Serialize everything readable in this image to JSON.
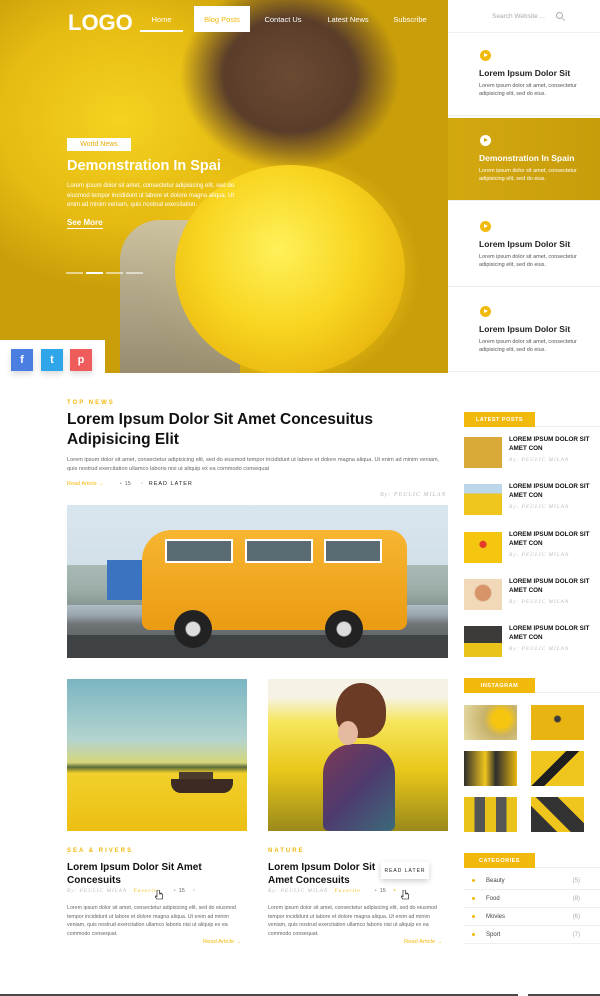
{
  "nav": {
    "logo": "LOGO",
    "items": [
      "Home",
      "Blog Posts",
      "Contact Us",
      "Latest News",
      "Subscribe"
    ],
    "search_placeholder": "Search Website ..."
  },
  "hero": {
    "badge": "World News",
    "title": "Demonstration In Spai",
    "body": "Lorem ipsum dolor sit amet, consectetur adipisicing elit, sed do eiusmod tempor incididunt ut labore et dolore magna aliqua. Ut enim ad minim veniam, quis nostrud exercitation.",
    "more": "See More"
  },
  "social": [
    "f",
    "t",
    "p"
  ],
  "slider_list": [
    {
      "title": "Lorem Ipsum Dolor Sit",
      "text": "Lorem ipsum dolor sit amet, consectetur adipisicing elit, sed do eius."
    },
    {
      "title": "Demonstration In Spain",
      "text": "Lorem ipsum dolor sit amet, consectetur adipisicing elit, sed do eius."
    },
    {
      "title": "Lorem Ipsum Dolor Sit",
      "text": "Lorem ipsum dolor sit amet, consectetur adipisicing elit, sed do eius."
    },
    {
      "title": "Lorem Ipsum Dolor Sit",
      "text": "Lorem ipsum dolor sit amet, consectetur adipisicing elit, sed do eius."
    }
  ],
  "main_article": {
    "kicker": "TOP NEWS",
    "title": "Lorem Ipsum Dolor Sit Amet Concesuitus Adipisicing Elit",
    "body": "Lorem ipsum dolor sit amet, consectetur adipisicing elit, sed do eiusmod tempor incididunt ut labore et dolore magna aliqua. Ut enim ad minim veniam, quis nostrud exercitation ullamco laboris nisi ut aliquip ex ea commodo consequat",
    "read": "Read Article →",
    "comments": "15",
    "read_later": "READ LATER",
    "byline": "By: PEULIC MILAN"
  },
  "cards": [
    {
      "kicker": "SEA & RIVERS",
      "title": "Lorem Ipsum Dolor Sit Amet Concesuits",
      "by": "By: PEULIC MILAN",
      "fav": "Favorite",
      "comments": "15",
      "text": "Lorem ipsum dolor sit amet, consectetur adipisicing elit, sed do eiusmod tempor incididunt ut labore et dolore magna aliqua. Ut enim ad minim veniam, quis nostrud exercitation ullamco laboris nisi ut aliquip ex ea commodo consequat.",
      "read": "Read Article →"
    },
    {
      "kicker": "NATURE",
      "title": "Lorem Ipsum Dolor Sit Amet Concesuits",
      "by": "By: PEULIC MILAN",
      "fav": "Favorite",
      "comments": "15",
      "text": "Lorem ipsum dolor sit amet, consectetur adipisicing elit, sed do eiusmod tempor incididunt ut labore et dolore magna aliqua. Ut enim ad minim veniam, quis nostrud exercitation ullamco laboris nisi ut aliquip ex ea commodo consequat.",
      "read": "Read Article →"
    }
  ],
  "tooltip": "READ LATER",
  "sidebar": {
    "latest_title": "LATEST POSTS",
    "latest": [
      {
        "title": "LOREM IPSUM DOLOR SIT AMET CON",
        "by": "By: PEULIC MILAN",
        "color": "#d9a93a"
      },
      {
        "title": "LOREM IPSUM DOLOR SIT AMET CON",
        "by": "By: PEULIC MILAN",
        "color": "#f0c51e"
      },
      {
        "title": "LOREM IPSUM DOLOR SIT AMET CON",
        "by": "By: PEULIC MILAN",
        "color": "#f5c60f"
      },
      {
        "title": "LOREM IPSUM DOLOR SIT AMET CON",
        "by": "By: PEULIC MILAN",
        "color": "#e2b189"
      },
      {
        "title": "LOREM IPSUM DOLOR SIT AMET CON",
        "by": "By: PEULIC MILAN",
        "color": "#3d3b3a"
      }
    ],
    "instagram_title": "INSTAGRAM",
    "categories_title": "CATEGORIES",
    "categories": [
      {
        "name": "Beauty",
        "count": "(5)"
      },
      {
        "name": "Food",
        "count": "(8)"
      },
      {
        "name": "Movies",
        "count": "(6)"
      },
      {
        "name": "Sport",
        "count": "(7)"
      }
    ]
  },
  "colors": {
    "accent": "#f2b90d",
    "facebook": "#4a7ee0",
    "twitter": "#2fa6e9",
    "pinterest": "#ef5c5c"
  }
}
